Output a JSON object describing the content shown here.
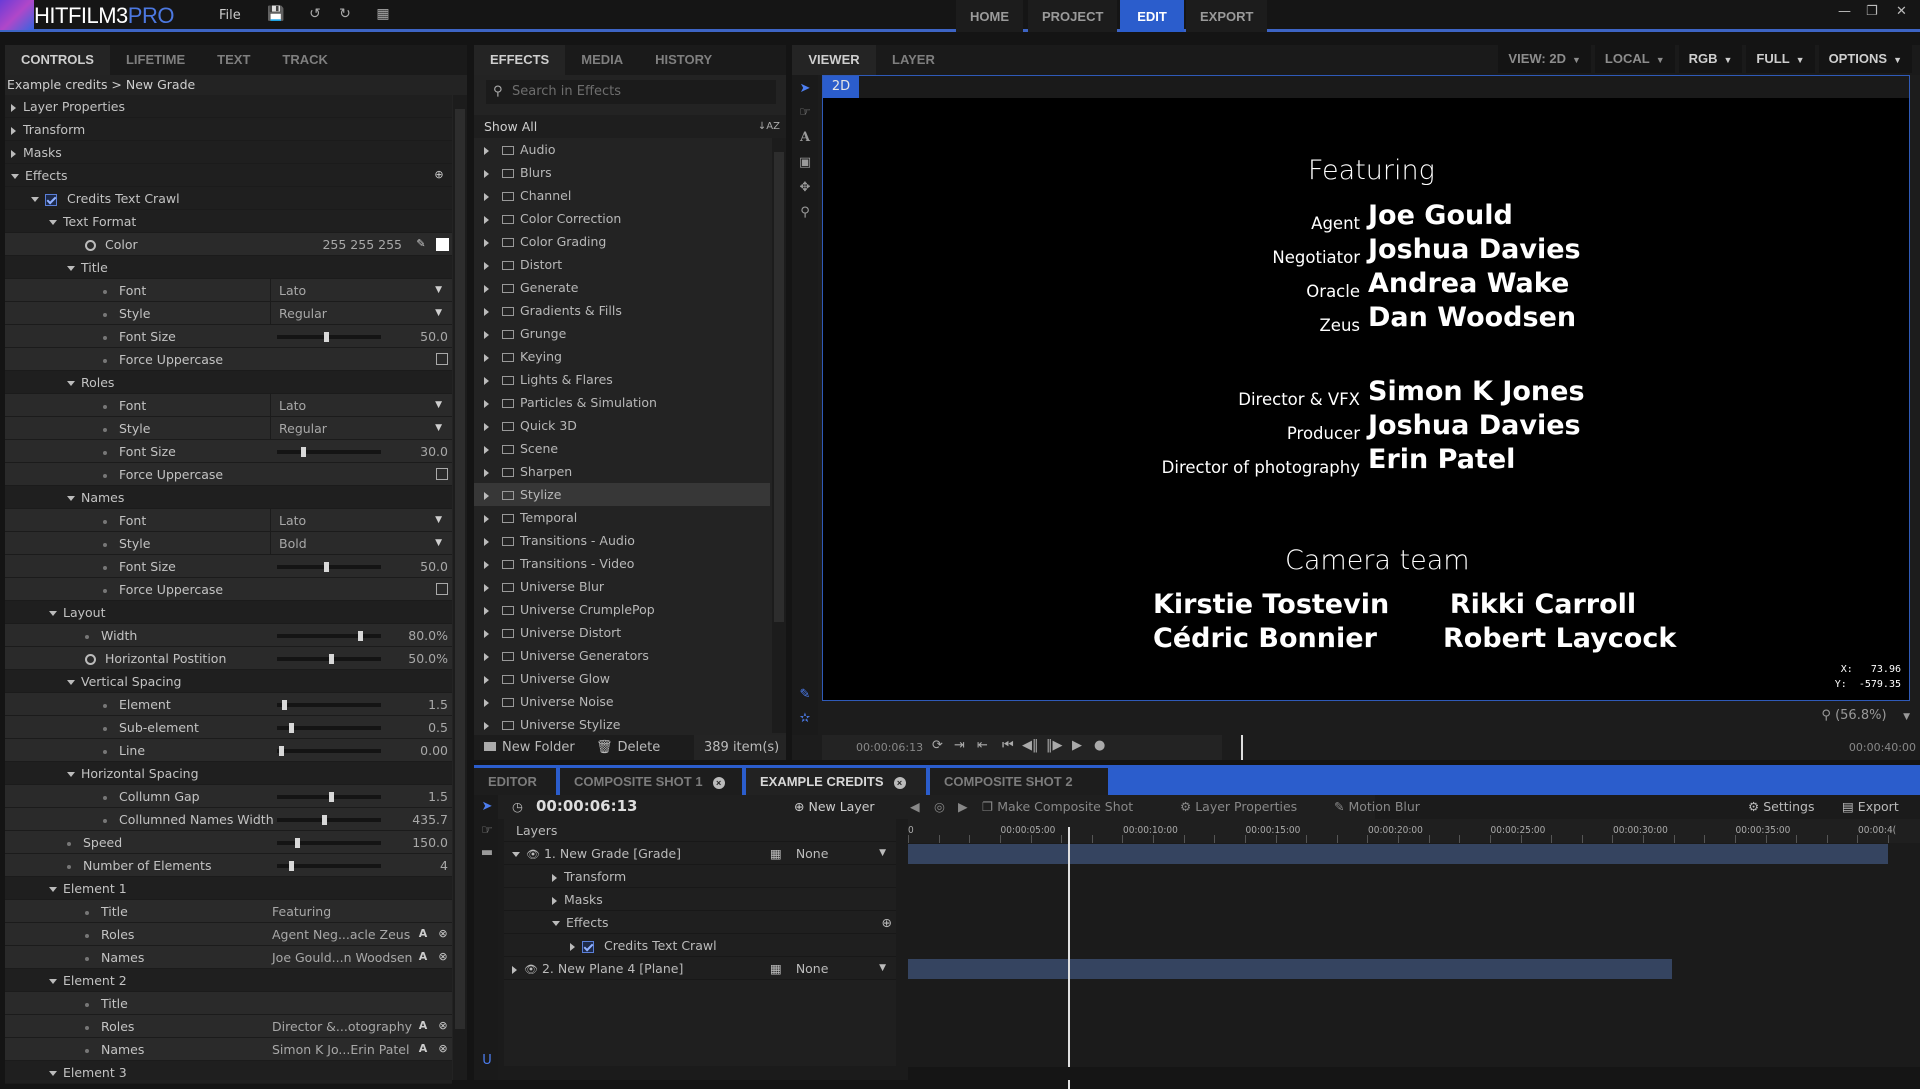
{
  "app": {
    "name_main": "HITFILM3",
    "name_pro": "PRO",
    "file_menu": "File",
    "toolbar_icons": [
      "save-icon",
      "undo-icon",
      "redo-icon",
      "grid-icon"
    ],
    "nav_tabs": [
      "HOME",
      "PROJECT",
      "EDIT",
      "EXPORT"
    ],
    "active_nav": "EDIT",
    "window_controls": [
      "minimize-icon",
      "restore-icon",
      "close-icon"
    ]
  },
  "controls": {
    "tabs": [
      "CONTROLS",
      "LIFETIME",
      "TEXT",
      "TRACK"
    ],
    "active_tab": "CONTROLS",
    "breadcrumb": "Example credits > New Grade",
    "rows": [
      {
        "type": "root",
        "label": "Layer Properties",
        "expanded": false,
        "indent": 0
      },
      {
        "type": "root",
        "label": "Transform",
        "expanded": false,
        "indent": 0
      },
      {
        "type": "root",
        "label": "Masks",
        "expanded": false,
        "indent": 0
      },
      {
        "type": "root",
        "label": "Effects",
        "expanded": true,
        "indent": 0,
        "add": true
      },
      {
        "type": "effect",
        "label": "Credits Text Crawl",
        "indent": 1,
        "checked": true
      },
      {
        "type": "group",
        "label": "Text Format",
        "indent": 2
      },
      {
        "type": "color",
        "label": "Color",
        "indent": 4,
        "value": "255   255   255",
        "keyframe": true
      },
      {
        "type": "group",
        "label": "Title",
        "indent": 3
      },
      {
        "type": "dropdown",
        "label": "Font",
        "indent": 5,
        "value": "Lato"
      },
      {
        "type": "dropdown",
        "label": "Style",
        "indent": 5,
        "value": "Regular"
      },
      {
        "type": "slider",
        "label": "Font Size",
        "indent": 5,
        "value": "50.0",
        "pos": 0.45
      },
      {
        "type": "check",
        "label": "Force Uppercase",
        "indent": 5,
        "checked": false
      },
      {
        "type": "group",
        "label": "Roles",
        "indent": 3
      },
      {
        "type": "dropdown",
        "label": "Font",
        "indent": 5,
        "value": "Lato"
      },
      {
        "type": "dropdown",
        "label": "Style",
        "indent": 5,
        "value": "Regular"
      },
      {
        "type": "slider",
        "label": "Font Size",
        "indent": 5,
        "value": "30.0",
        "pos": 0.23
      },
      {
        "type": "check",
        "label": "Force Uppercase",
        "indent": 5,
        "checked": false
      },
      {
        "type": "group",
        "label": "Names",
        "indent": 3
      },
      {
        "type": "dropdown",
        "label": "Font",
        "indent": 5,
        "value": "Lato"
      },
      {
        "type": "dropdown",
        "label": "Style",
        "indent": 5,
        "value": "Bold"
      },
      {
        "type": "slider",
        "label": "Font Size",
        "indent": 5,
        "value": "50.0",
        "pos": 0.45
      },
      {
        "type": "check",
        "label": "Force Uppercase",
        "indent": 5,
        "checked": false
      },
      {
        "type": "group",
        "label": "Layout",
        "indent": 2
      },
      {
        "type": "slider",
        "label": "Width",
        "indent": 4,
        "value": "80.0%",
        "pos": 0.78
      },
      {
        "type": "slider",
        "label": "Horizontal Postition",
        "indent": 4,
        "value": "50.0%",
        "pos": 0.5,
        "keyframe": true
      },
      {
        "type": "group",
        "label": "Vertical Spacing",
        "indent": 3
      },
      {
        "type": "slider",
        "label": "Element",
        "indent": 5,
        "value": "1.5",
        "pos": 0.05
      },
      {
        "type": "slider",
        "label": "Sub-element",
        "indent": 5,
        "value": "0.5",
        "pos": 0.12
      },
      {
        "type": "slider",
        "label": "Line",
        "indent": 5,
        "value": "0.00",
        "pos": 0.02
      },
      {
        "type": "group",
        "label": "Horizontal Spacing",
        "indent": 3
      },
      {
        "type": "slider",
        "label": "Collumn Gap",
        "indent": 5,
        "value": "1.5",
        "pos": 0.5
      },
      {
        "type": "slider",
        "label": "Collumned Names Width",
        "indent": 5,
        "value": "435.7",
        "pos": 0.43
      },
      {
        "type": "slider",
        "label": "Speed",
        "indent": 3,
        "value": "150.0",
        "pos": 0.17
      },
      {
        "type": "slider",
        "label": "Number of Elements",
        "indent": 3,
        "value": "4",
        "pos": 0.12
      },
      {
        "type": "group",
        "label": "Element 1",
        "indent": 2
      },
      {
        "type": "text",
        "label": "Title",
        "indent": 4,
        "value": "Featuring"
      },
      {
        "type": "textbtn",
        "label": "Roles",
        "indent": 4,
        "value": "Agent Neg...acle Zeus"
      },
      {
        "type": "textbtn",
        "label": "Names",
        "indent": 4,
        "value": "Joe Gould...n Woodsen"
      },
      {
        "type": "group",
        "label": "Element 2",
        "indent": 2
      },
      {
        "type": "text",
        "label": "Title",
        "indent": 4,
        "value": ""
      },
      {
        "type": "textbtn",
        "label": "Roles",
        "indent": 4,
        "value": "Director &...otography"
      },
      {
        "type": "textbtn",
        "label": "Names",
        "indent": 4,
        "value": "Simon K Jo...Erin Patel"
      },
      {
        "type": "group",
        "label": "Element 3",
        "indent": 2
      }
    ]
  },
  "effects": {
    "tabs": [
      "EFFECTS",
      "MEDIA",
      "HISTORY"
    ],
    "active_tab": "EFFECTS",
    "search_placeholder": "Search in Effects",
    "show_all": "Show All",
    "folders": [
      "Audio",
      "Blurs",
      "Channel",
      "Color Correction",
      "Color Grading",
      "Distort",
      "Generate",
      "Gradients & Fills",
      "Grunge",
      "Keying",
      "Lights & Flares",
      "Particles & Simulation",
      "Quick 3D",
      "Scene",
      "Sharpen",
      "Stylize",
      "Temporal",
      "Transitions - Audio",
      "Transitions - Video",
      "Universe Blur",
      "Universe CrumplePop",
      "Universe Distort",
      "Universe Generators",
      "Universe Glow",
      "Universe Noise",
      "Universe Stylize"
    ],
    "selected": "Stylize",
    "new_folder": "New Folder",
    "delete": "Delete",
    "count": "389 item(s)"
  },
  "viewer": {
    "tabs": [
      "VIEWER",
      "LAYER"
    ],
    "active_tab": "VIEWER",
    "options": [
      "VIEW: 2D",
      "LOCAL",
      "RGB",
      "FULL",
      "OPTIONS"
    ],
    "mode_tag": "2D",
    "credits": {
      "title1": "Featuring",
      "roles1": [
        "Agent",
        "Negotiator",
        "Oracle",
        "Zeus"
      ],
      "names1": [
        "Joe Gould",
        "Joshua Davies",
        "Andrea Wake",
        "Dan Woodsen"
      ],
      "roles2": [
        "Director & VFX",
        "Producer",
        "Director of photography"
      ],
      "names2": [
        "Simon K Jones",
        "Joshua Davies",
        "Erin Patel"
      ],
      "title3": "Camera team",
      "col_a": [
        "Kirstie Tostevin",
        "Cédric Bonnier"
      ],
      "col_b": [
        "Rikki Carroll",
        "Robert Laycock"
      ]
    },
    "coords": {
      "x_label": "X:",
      "x": "73.96",
      "y_label": "Y:",
      "y": "-579.35"
    },
    "zoom": "(56.8%)",
    "current_time": "00:00:06:13",
    "end_time": "00:00:40:00",
    "playhead_fraction": 0.163
  },
  "timeline": {
    "tabs": [
      {
        "label": "EDITOR",
        "closable": false
      },
      {
        "label": "COMPOSITE SHOT 1",
        "closable": true
      },
      {
        "label": "EXAMPLE CREDITS",
        "closable": true,
        "active": true
      },
      {
        "label": "COMPOSITE SHOT 2",
        "closable": true
      }
    ],
    "time": "00:00:06:13",
    "new_layer": "New Layer",
    "make_composite": "Make Composite Shot",
    "layer_properties": "Layer Properties",
    "motion_blur": "Motion Blur",
    "settings": "Settings",
    "export": "Export",
    "layers_header": "Layers",
    "ruler": [
      "0",
      "00:00:05:00",
      "00:00:10:00",
      "00:00:15:00",
      "00:00:20:00",
      "00:00:25:00",
      "00:00:30:00",
      "00:00:35:00",
      "00:00:4("
    ],
    "rows": [
      {
        "label": "1. New Grade [Grade]",
        "blend": "None",
        "top": true
      },
      {
        "label": "Transform"
      },
      {
        "label": "Masks"
      },
      {
        "label": "Effects"
      },
      {
        "label": "Credits Text Crawl"
      },
      {
        "label": "2. New Plane 4 [Plane]",
        "blend": "None",
        "top": true
      }
    ],
    "bars": [
      {
        "start": 0,
        "end": 1.0
      },
      {
        "start": 0,
        "end": 0.78
      }
    ]
  }
}
